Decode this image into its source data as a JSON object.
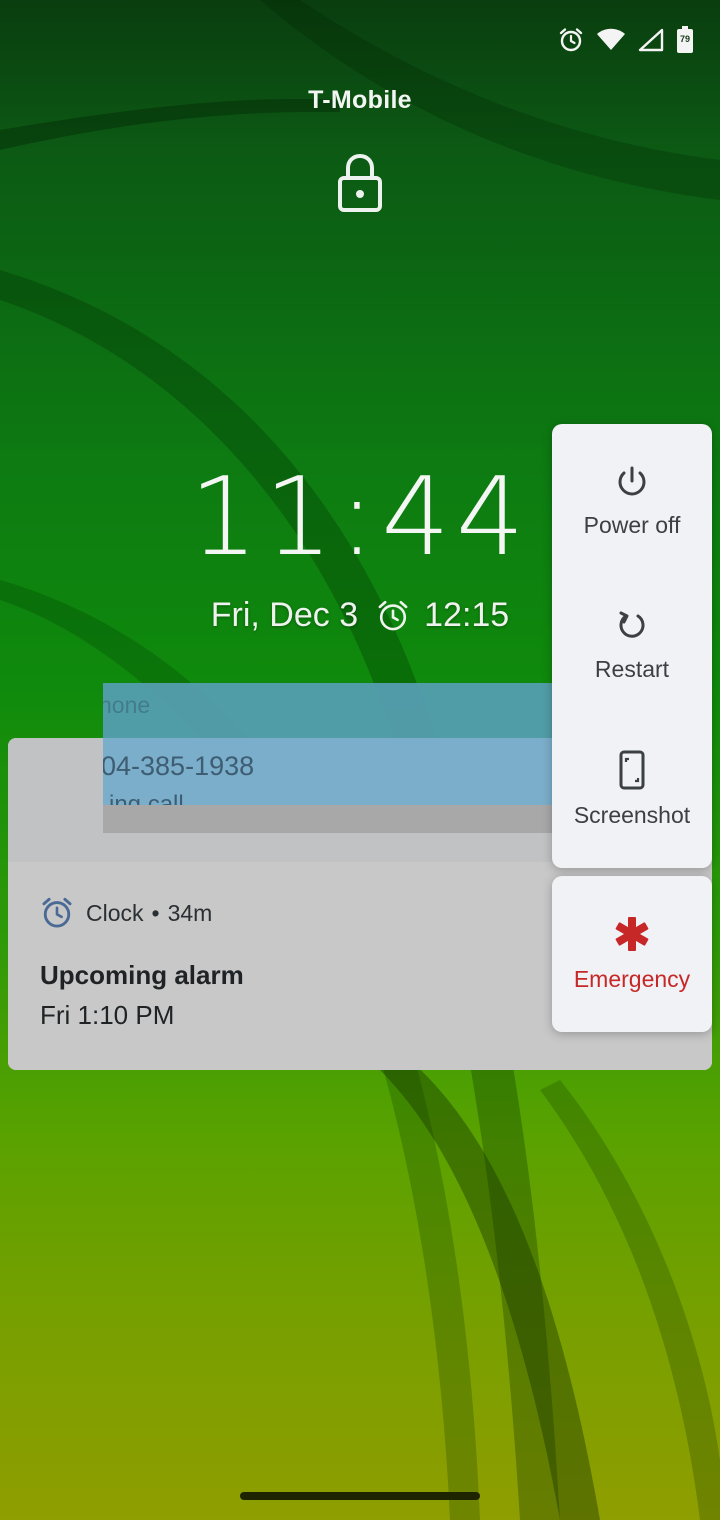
{
  "status_bar": {
    "icons": [
      "alarm-icon",
      "wifi-icon",
      "cell-signal-icon",
      "battery-icon"
    ],
    "battery_level": "79"
  },
  "lockscreen": {
    "carrier": "T-Mobile",
    "time": "11:44",
    "date": "Fri, Dec 3",
    "next_alarm": "12:15"
  },
  "incoming_call": {
    "label": "hone",
    "number": "04-385-1938",
    "sub": "ing call"
  },
  "notification": {
    "app": "Clock",
    "age": "34m",
    "separator": "•",
    "title": "Upcoming alarm",
    "body": "Fri 1:10 PM"
  },
  "power_menu": {
    "items": [
      {
        "label": "Power off",
        "icon": "power-icon"
      },
      {
        "label": "Restart",
        "icon": "restart-icon"
      },
      {
        "label": "Screenshot",
        "icon": "screenshot-icon"
      }
    ],
    "emergency": {
      "label": "Emergency",
      "icon": "emergency-icon",
      "color": "#c62828"
    }
  },
  "colors": {
    "wallpaper_top": "#0a3d0f",
    "wallpaper_mid": "#0f8a0c",
    "wallpaper_bottom": "#8f9e00",
    "menu_background": "#f1f2f5",
    "notification_background": "#c8c8c8"
  }
}
